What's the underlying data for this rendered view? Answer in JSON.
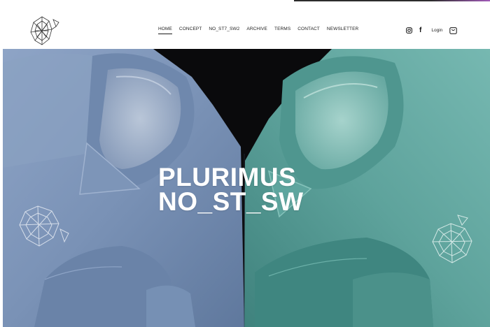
{
  "nav": {
    "items": [
      {
        "label": "HOME",
        "active": true
      },
      {
        "label": "CONCEPT",
        "active": false
      },
      {
        "label": "NO_ST7_SW2",
        "active": false
      },
      {
        "label": "ARCHIVE",
        "active": false
      },
      {
        "label": "TERMS",
        "active": false
      },
      {
        "label": "CONTACT",
        "active": false
      },
      {
        "label": "NEWSLETTER",
        "active": false
      }
    ]
  },
  "header_actions": {
    "instagram_icon": "instagram-icon",
    "facebook_glyph": "f",
    "login_label": "Login",
    "cart_icon": "shopping-bag-icon"
  },
  "hero": {
    "title_line1": "PLURIMUS",
    "title_line2": "NO_ST_SW"
  },
  "colors": {
    "sweater_left": "#7b93b5",
    "sweater_right": "#5fa6a0",
    "background": "#0a0a0c",
    "text": "#ffffff"
  }
}
